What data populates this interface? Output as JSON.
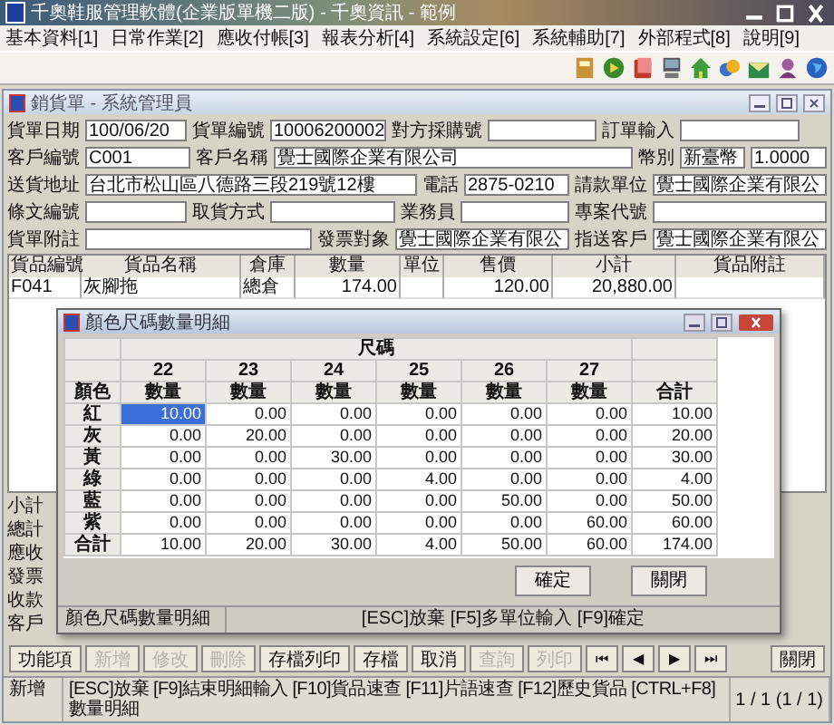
{
  "app_title": "千奧鞋服管理軟體(企業版單機二版) - 千奧資訊 - 範例",
  "menu": [
    {
      "label": "基本資料[1]"
    },
    {
      "label": "日常作業[2]"
    },
    {
      "label": "應收付帳[3]"
    },
    {
      "label": "報表分析[4]"
    },
    {
      "label": "系統設定[6]"
    },
    {
      "label": "系統輔助[7]"
    },
    {
      "label": "外部程式[8]"
    },
    {
      "label": "說明[9]"
    }
  ],
  "document_window": {
    "title": "銷貨單 - 系統管理員"
  },
  "form_rows": [
    [
      {
        "label": "貨單日期",
        "values": [
          "100/06/20"
        ]
      },
      {
        "label": "貨單編號",
        "values": [
          "10006200002"
        ]
      },
      {
        "label": "對方採購號"
      },
      {
        "label": "訂單輸入"
      }
    ],
    [
      {
        "label": "客戶編號",
        "values": [
          "C001"
        ]
      },
      {
        "label": "客戶名稱",
        "values": [
          "覺士國際企業有限公司"
        ]
      },
      {
        "label": "幣別",
        "values": [
          "新臺幣",
          "1.0000"
        ]
      }
    ],
    [
      {
        "label": "送貨地址",
        "values": [
          "台北市松山區八德路三段219號12樓"
        ]
      },
      {
        "label": "電話",
        "values": [
          "2875-0210"
        ]
      },
      {
        "label": "請款單位",
        "values": [
          "覺士國際企業有限公"
        ]
      }
    ],
    [
      {
        "label": "條文編號"
      },
      {
        "label": "取貨方式"
      },
      {
        "label": "業務員"
      },
      {
        "label": "專案代號"
      }
    ],
    [
      {
        "label": "貨單附註"
      },
      {
        "label": "發票對象",
        "values": [
          "覺士國際企業有限公"
        ]
      },
      {
        "label": "指送客戶",
        "values": [
          "覺士國際企業有限公"
        ]
      }
    ]
  ],
  "items_table": {
    "columns": [
      "貨品編號",
      "貨品名稱",
      "倉庫",
      "數量",
      "單位",
      "售價",
      "小計",
      "貨品附註"
    ],
    "rows": [
      [
        "F041",
        "灰腳拖",
        "總倉",
        "174.00",
        "",
        "120.00",
        "20,880.00",
        ""
      ]
    ]
  },
  "side_labels": [
    "小計",
    "總計",
    "應收",
    "發票",
    "收款",
    "客戶"
  ],
  "actions": [
    {
      "label": "功能項",
      "disabled": false
    },
    {
      "label": "新增",
      "disabled": true
    },
    {
      "label": "修改",
      "disabled": true
    },
    {
      "label": "刪除",
      "disabled": true
    },
    {
      "label": "存檔列印",
      "disabled": false
    },
    {
      "label": "存檔",
      "disabled": false
    },
    {
      "label": "取消",
      "disabled": false
    },
    {
      "label": "查詢",
      "disabled": true
    },
    {
      "label": "列印",
      "disabled": true
    },
    {
      "label": "⏮",
      "disabled": false
    },
    {
      "label": "◀",
      "disabled": false
    },
    {
      "label": "▶",
      "disabled": false
    },
    {
      "label": "⏭",
      "disabled": false
    },
    {
      "label": "關閉",
      "disabled": false
    }
  ],
  "status_bar": [
    "新增",
    "[ESC]放棄 [F9]結束明細輸入 [F10]貨品速查 [F11]片語速查 [F12]歷史貨品 [CTRL+F8]數量明細",
    "1 / 1 (1 / 1)"
  ],
  "dialog": {
    "title": "顏色尺碼數量明細",
    "group_header": "尺碼",
    "sizes": [
      "22",
      "23",
      "24",
      "25",
      "26",
      "27"
    ],
    "color_header": "顏色",
    "subheaders": [
      "數量",
      "數量",
      "數量",
      "數量",
      "數量",
      "數量",
      "合計"
    ],
    "rows": [
      {
        "label": "紅",
        "cells": [
          {
            "v": "10.00",
            "selected": true
          },
          {
            "v": "0.00",
            "selected": false
          },
          {
            "v": "0.00",
            "selected": false
          },
          {
            "v": "0.00",
            "selected": false
          },
          {
            "v": "0.00",
            "selected": false
          },
          {
            "v": "0.00",
            "selected": false
          },
          {
            "v": "10.00",
            "selected": false
          }
        ]
      },
      {
        "label": "灰",
        "cells": [
          {
            "v": "0.00",
            "selected": false
          },
          {
            "v": "20.00",
            "selected": false
          },
          {
            "v": "0.00",
            "selected": false
          },
          {
            "v": "0.00",
            "selected": false
          },
          {
            "v": "0.00",
            "selected": false
          },
          {
            "v": "0.00",
            "selected": false
          },
          {
            "v": "20.00",
            "selected": false
          }
        ]
      },
      {
        "label": "黃",
        "cells": [
          {
            "v": "0.00",
            "selected": false
          },
          {
            "v": "0.00",
            "selected": false
          },
          {
            "v": "30.00",
            "selected": false
          },
          {
            "v": "0.00",
            "selected": false
          },
          {
            "v": "0.00",
            "selected": false
          },
          {
            "v": "0.00",
            "selected": false
          },
          {
            "v": "30.00",
            "selected": false
          }
        ]
      },
      {
        "label": "綠",
        "cells": [
          {
            "v": "0.00",
            "selected": false
          },
          {
            "v": "0.00",
            "selected": false
          },
          {
            "v": "0.00",
            "selected": false
          },
          {
            "v": "4.00",
            "selected": false
          },
          {
            "v": "0.00",
            "selected": false
          },
          {
            "v": "0.00",
            "selected": false
          },
          {
            "v": "4.00",
            "selected": false
          }
        ]
      },
      {
        "label": "藍",
        "cells": [
          {
            "v": "0.00",
            "selected": false
          },
          {
            "v": "0.00",
            "selected": false
          },
          {
            "v": "0.00",
            "selected": false
          },
          {
            "v": "0.00",
            "selected": false
          },
          {
            "v": "50.00",
            "selected": false
          },
          {
            "v": "0.00",
            "selected": false
          },
          {
            "v": "50.00",
            "selected": false
          }
        ]
      },
      {
        "label": "紫",
        "cells": [
          {
            "v": "0.00",
            "selected": false
          },
          {
            "v": "0.00",
            "selected": false
          },
          {
            "v": "0.00",
            "selected": false
          },
          {
            "v": "0.00",
            "selected": false
          },
          {
            "v": "0.00",
            "selected": false
          },
          {
            "v": "60.00",
            "selected": false
          },
          {
            "v": "60.00",
            "selected": false
          }
        ]
      }
    ],
    "total_row": {
      "label": "合計",
      "cells": [
        "10.00",
        "20.00",
        "30.00",
        "4.00",
        "50.00",
        "60.00",
        "174.00"
      ]
    },
    "buttons": [
      "確定",
      "關閉"
    ],
    "status_bar": [
      "顏色尺碼數量明細",
      "[ESC]放棄 [F5]多單位輸入 [F9]確定"
    ]
  }
}
